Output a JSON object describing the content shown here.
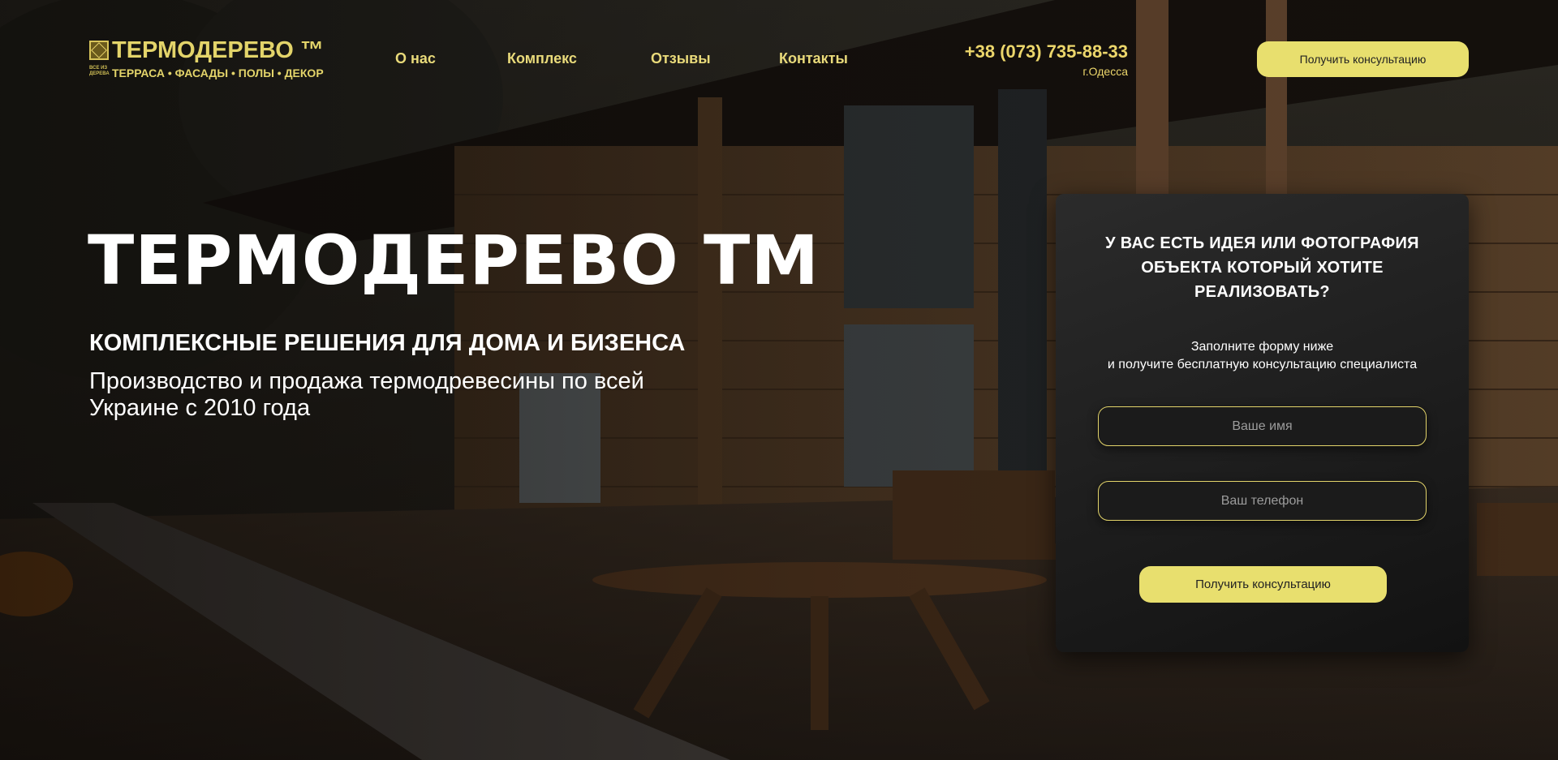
{
  "logo": {
    "title": "ТЕРМОДЕРЕВО ™",
    "small": "ВСЕ ИЗ ДЕРЕВА",
    "subtitle": "ТЕРРАСА • ФАСАДЫ • ПОЛЫ • ДЕКОР"
  },
  "nav": {
    "items": [
      {
        "label": "О нас"
      },
      {
        "label": "Комплекс"
      },
      {
        "label": "Отзывы"
      },
      {
        "label": "Контакты"
      }
    ]
  },
  "contact": {
    "phone": "+38 (073) 735-88-33",
    "city": "г.Одесса"
  },
  "header_cta": {
    "label": "Получить консультацию"
  },
  "hero": {
    "title": "ТЕРМОДЕРЕВО ТМ",
    "subtitle": "КОМПЛЕКСНЫЕ РЕШЕНИЯ ДЛЯ ДОМА И БИЗЕНСА",
    "description": "Производство и продажа термодревесины по всей Украине с 2010 года"
  },
  "form": {
    "heading": "У ВАС ЕСТЬ ИДЕЯ ИЛИ ФОТОГРАФИЯ ОБЪЕКТА КОТОРЫЙ ХОТИТЕ РЕАЛИЗОВАТЬ?",
    "lead_line1": "Заполните форму ниже",
    "lead_line2": "и получите бесплатную консультацию специалиста",
    "name_placeholder": "Ваше имя",
    "phone_placeholder": "Ваш телефон",
    "submit_label": "Получить консультацию"
  },
  "colors": {
    "accent": "#e8df6e",
    "logo_gold": "#e3d46a",
    "form_bg": "#1c1c1c"
  }
}
